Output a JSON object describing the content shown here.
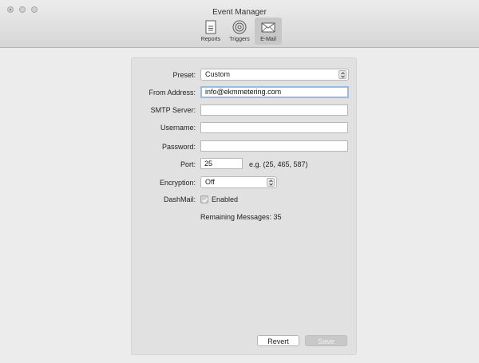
{
  "window": {
    "title": "Event Manager"
  },
  "toolbar": {
    "items": [
      {
        "label": "Reports",
        "icon": "document-icon"
      },
      {
        "label": "Triggers",
        "icon": "target-icon"
      },
      {
        "label": "E-Mail",
        "icon": "envelope-icon",
        "active": true
      }
    ]
  },
  "form": {
    "preset": {
      "label": "Preset:",
      "value": "Custom"
    },
    "from_address": {
      "label": "From Address:",
      "value": "info@ekmmetering.com"
    },
    "smtp_server": {
      "label": "SMTP Server:",
      "value": ""
    },
    "username": {
      "label": "Username:",
      "value": ""
    },
    "password": {
      "label": "Password:",
      "value": ""
    },
    "port": {
      "label": "Port:",
      "value": "25",
      "hint": "e.g. (25, 465, 587)"
    },
    "encryption": {
      "label": "Encryption:",
      "value": "Off"
    },
    "dashmail": {
      "label": "DashMail:",
      "checkbox_label": "Enabled",
      "checked": true
    },
    "remaining": "Remaining Messages: 35"
  },
  "buttons": {
    "revert": "Revert",
    "save": "Save"
  },
  "colors": {
    "focus_ring": "#9ab9e8",
    "panel": "#e1e1e1",
    "window_bg": "#ececec"
  }
}
